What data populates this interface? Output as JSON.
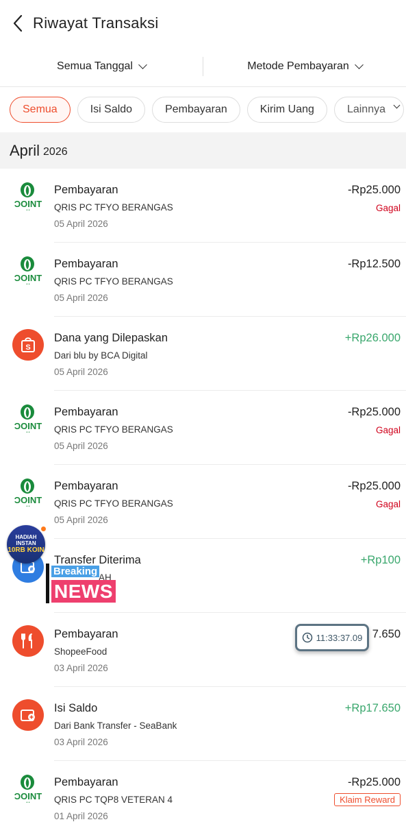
{
  "header": {
    "title": "Riwayat Transaksi"
  },
  "filters": {
    "date": "Semua Tanggal",
    "method": "Metode Pembayaran"
  },
  "chips": [
    {
      "label": "Semua",
      "active": true
    },
    {
      "label": "Isi Saldo"
    },
    {
      "label": "Pembayaran"
    },
    {
      "label": "Kirim Uang"
    },
    {
      "label": "Lainnya"
    }
  ],
  "month": {
    "name": "April",
    "year": "2026"
  },
  "transactions": [
    {
      "icon": "qris-point-icon",
      "title": "Pembayaran",
      "subtitle": "QRIS PC TFYO BERANGAS",
      "date": "05 April 2026",
      "amount": "-Rp25.000",
      "status": "Gagal"
    },
    {
      "icon": "qris-point-icon",
      "title": "Pembayaran",
      "subtitle": "QRIS PC TFYO BERANGAS",
      "date": "05 April 2026",
      "amount": "-Rp12.500"
    },
    {
      "icon": "shopee-bag-icon",
      "title": "Dana yang Dilepaskan",
      "subtitle": "Dari blu by BCA Digital",
      "date": "05 April 2026",
      "amount": "+Rp26.000"
    },
    {
      "icon": "qris-point-icon",
      "title": "Pembayaran",
      "subtitle": "QRIS PC TFYO BERANGAS",
      "date": "05 April 2026",
      "amount": "-Rp25.000",
      "status": "Gagal"
    },
    {
      "icon": "qris-point-icon",
      "title": "Pembayaran",
      "subtitle": "QRIS PC TFYO BERANGAS",
      "date": "05 April 2026",
      "amount": "-Rp25.000",
      "status": "Gagal"
    },
    {
      "icon": "transfer-wallet-icon",
      "title": "Transfer Diterima",
      "subtitle": "AH",
      "date": "",
      "amount": "+Rp100"
    },
    {
      "icon": "food-icon",
      "title": "Pembayaran",
      "subtitle": "ShopeeFood",
      "date": "03 April 2026",
      "amount": "7.650"
    },
    {
      "icon": "wallet-topup-icon",
      "title": "Isi Saldo",
      "subtitle": "Dari Bank Transfer - SeaBank",
      "date": "03 April 2026",
      "amount": "+Rp17.650"
    },
    {
      "icon": "qris-point-icon",
      "title": "Pembayaran",
      "subtitle": "QRIS PC TQP8 VETERAN 4",
      "date": "01 April 2026",
      "amount": "-Rp25.000",
      "badge": "Klaim Reward"
    }
  ],
  "overlays": {
    "game": {
      "line1": "HADIAH INSTAN",
      "line2": "10RB KOIN"
    },
    "breaking": {
      "top": "Breaking",
      "bottom": "NEWS"
    },
    "clock": {
      "time": "11:33:37.09"
    }
  },
  "colors": {
    "accent": "#ee4d2d",
    "positive": "#3aa76d",
    "failed": "#d0011b",
    "point_green": "#1a8b3c"
  }
}
